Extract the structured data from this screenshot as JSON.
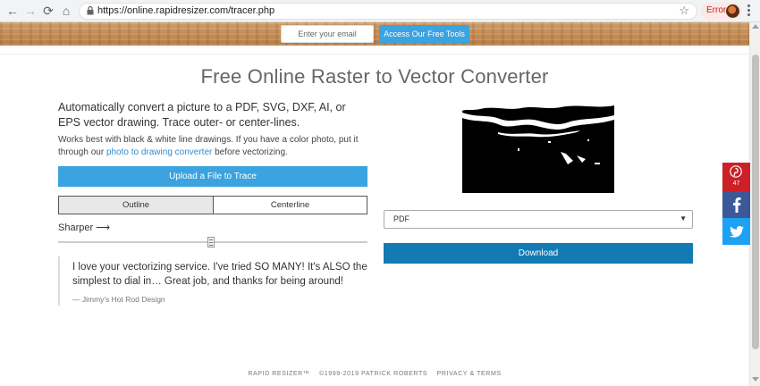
{
  "browser": {
    "url": "https://online.rapidresizer.com/tracer.php",
    "error_label": "Error"
  },
  "banner": {
    "email_placeholder": "Enter your email",
    "tools_button": "Access Our Free Tools"
  },
  "main": {
    "title": "Free Online Raster to Vector Converter",
    "lead": "Automatically convert a picture to a PDF, SVG, DXF, AI, or EPS vector drawing. Trace outer- or center-lines.",
    "note_prefix": "Works best with black & white line drawings. If you have a color photo, put it through our ",
    "note_link": "photo to drawing converter",
    "note_suffix": " before vectorizing.",
    "upload_button": "Upload a File to Trace",
    "tabs": [
      {
        "label": "Outline",
        "active": true
      },
      {
        "label": "Centerline",
        "active": false
      }
    ],
    "sharper_label": "Sharper ⟶",
    "slider_value": 0.5,
    "testimonial": {
      "quote": "I love your vectorizing service. I've tried SO MANY! It's ALSO the simplest to dial in… Great job, and thanks for being around!",
      "author": "— Jimmy's Hot Rod Design"
    },
    "format_select": {
      "value": "PDF"
    },
    "download_button": "Download"
  },
  "share": {
    "pinterest_count": "47"
  },
  "footer": {
    "brand": "RAPID RESIZER™",
    "copyright": "©1999-2019 PATRICK ROBERTS",
    "privacy": "PRIVACY & TERMS"
  },
  "colors": {
    "accent": "#3aa3e0",
    "download": "#137ab3",
    "pinterest": "#cb2027",
    "facebook": "#3b5998",
    "twitter": "#1da1f2"
  }
}
